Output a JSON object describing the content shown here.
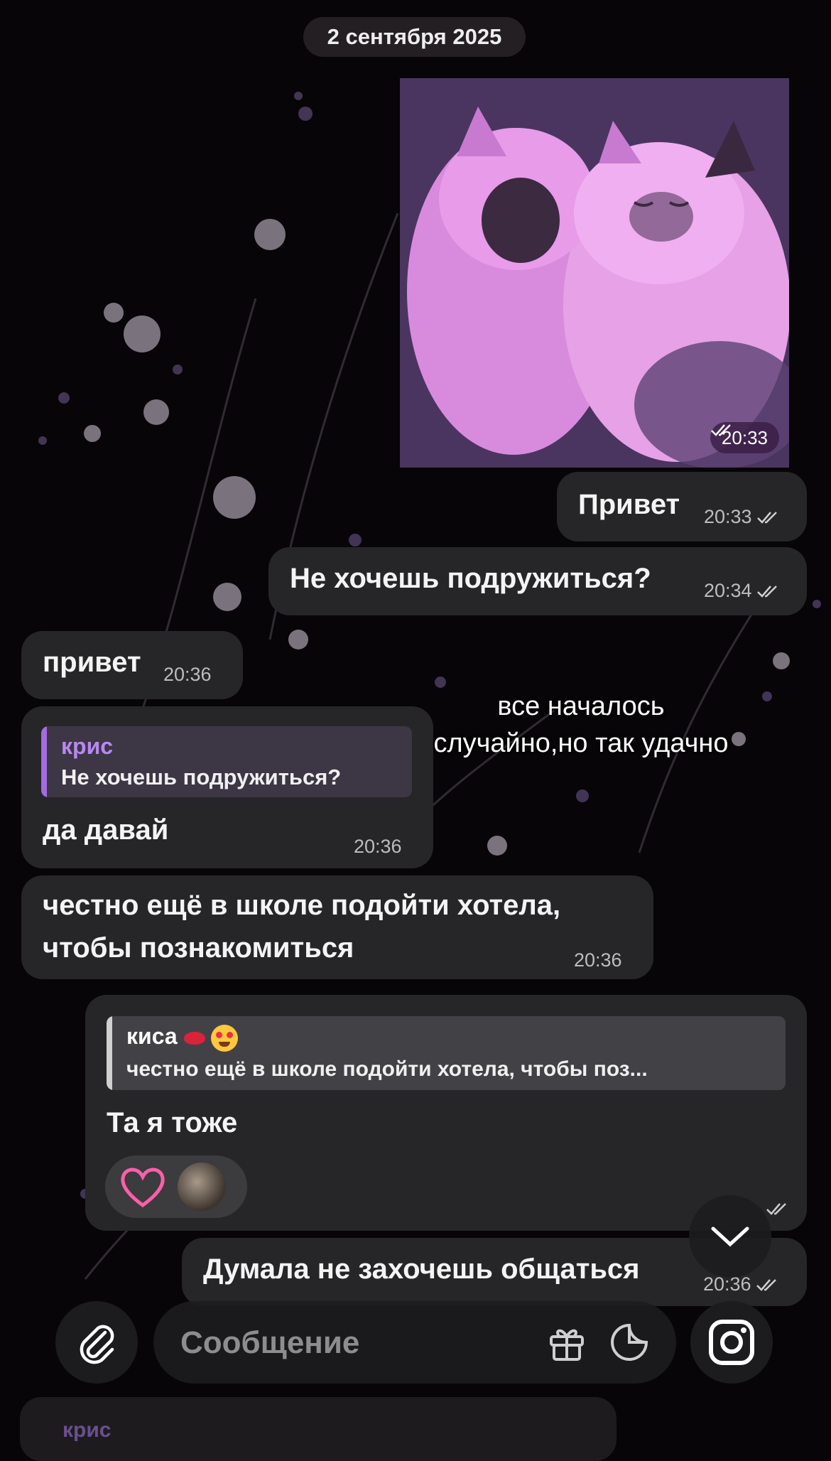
{
  "date_label": "2 сентября 2025",
  "photo": {
    "time": "20:33",
    "subject": "two pink-tinted kittens hugging"
  },
  "messages": [
    {
      "id": "m1",
      "side": "out",
      "text": "Привет",
      "time": "20:33"
    },
    {
      "id": "m2",
      "side": "out",
      "text": "Не хочешь подружиться?",
      "time": "20:34"
    },
    {
      "id": "m3",
      "side": "in",
      "text": "привет",
      "time": "20:36"
    },
    {
      "id": "m4",
      "side": "in",
      "reply_name": "крис",
      "reply_text": "Не хочешь подружиться?",
      "text": "да давай",
      "time": "20:36"
    },
    {
      "id": "m5",
      "side": "in",
      "lines": [
        "честно ещё в школе подойти хотела,",
        "чтобы познакомиться"
      ],
      "time": "20:36"
    },
    {
      "id": "m6",
      "side": "out",
      "reply_name": "киса",
      "reply_text": "честно ещё в школе подойти хотела, чтобы поз...",
      "text": "Та я тоже",
      "reaction": "heart"
    },
    {
      "id": "m7",
      "side": "out",
      "text": "Думала не захочешь общаться",
      "time": "20:36"
    }
  ],
  "caption": [
    "все началось",
    "случайно,но так удачно"
  ],
  "composer": {
    "placeholder": "Сообщение"
  },
  "partial_bottom": {
    "name": "крис"
  },
  "colors": {
    "bubble": "#262527",
    "reply_bar_in": "#a46ce0",
    "accent_pink": "#ff5fa8"
  },
  "icons": [
    "double-check-icon",
    "attach-icon",
    "gift-icon",
    "sticker-icon",
    "instagram-icon",
    "chevron-down-icon",
    "heart-reaction-icon",
    "lips-emoji-icon",
    "heart-eyes-emoji-icon"
  ]
}
